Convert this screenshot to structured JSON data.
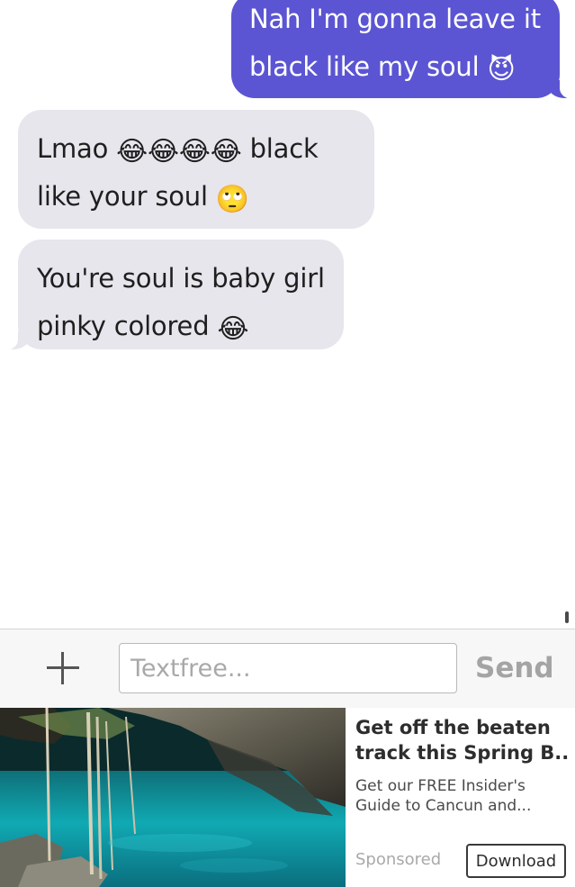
{
  "messages": [
    {
      "direction": "outgoing",
      "lines": [
        {
          "text": "Nah I'm gonna leave it",
          "emoji": ""
        },
        {
          "text": "black like my soul ",
          "emoji": "😈"
        }
      ]
    },
    {
      "direction": "incoming",
      "lines": [
        {
          "text": "Lmao ",
          "emoji": "😂😂😂😂",
          "after": " black"
        },
        {
          "text": "like your soul ",
          "emoji": "🙄"
        }
      ]
    },
    {
      "direction": "incoming",
      "lines": [
        {
          "text": "You're soul is baby girl",
          "emoji": ""
        },
        {
          "text": "pinky colored ",
          "emoji": "😂"
        }
      ]
    }
  ],
  "compose": {
    "placeholder": "Textfree...",
    "send_label": "Send",
    "add_icon": "plus-icon"
  },
  "ad": {
    "title_line1": "Get off the beaten",
    "title_line2": "track this Spring B...",
    "desc_line1": "Get our FREE Insider's",
    "desc_line2": "Guide to Cancun and...",
    "sponsored_label": "Sponsored",
    "download_label": "Download"
  },
  "colors": {
    "outgoing_bubble": "#5b55d3",
    "incoming_bubble": "#e6e6ec",
    "send_disabled": "#a4a4a4"
  }
}
